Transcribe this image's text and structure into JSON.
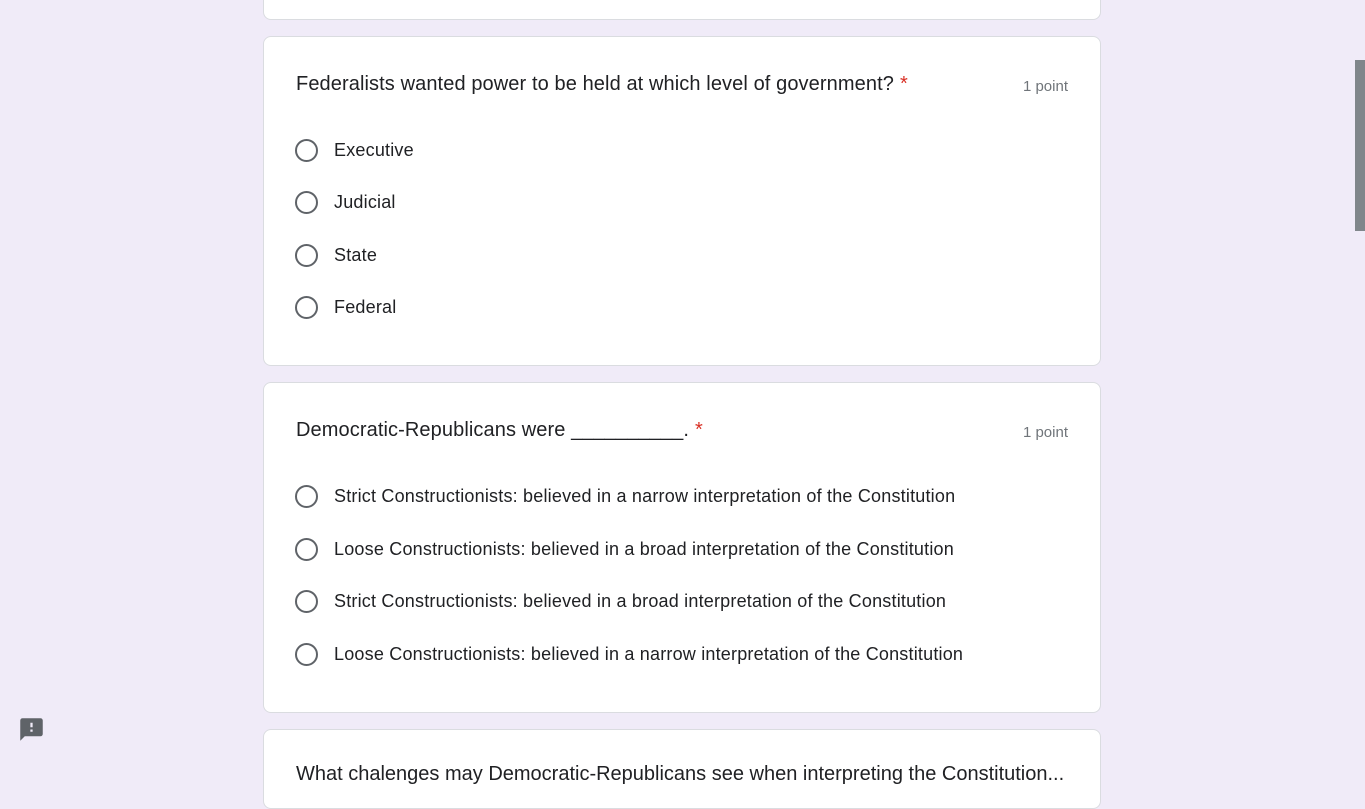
{
  "questions": [
    {
      "title": "Federalists wanted power to be held at which level of government?",
      "required_mark": "*",
      "points": "1 point",
      "options": [
        "Executive",
        "Judicial",
        "State",
        "Federal"
      ]
    },
    {
      "title": "Democratic-Republicans were __________.",
      "required_mark": "*",
      "points": "1 point",
      "options": [
        "Strict Constructionists: believed in a narrow interpretation of the Constitution",
        "Loose Constructionists: believed in a broad interpretation of the Constitution",
        "Strict Constructionists: believed in a broad interpretation of the Constitution",
        "Loose Constructionists: believed in a narrow interpretation of the Constitution"
      ]
    }
  ],
  "next_question": {
    "title": "What chalenges may Democratic-Republicans see when interpreting the Constitution..."
  },
  "icons": {
    "feedback": "report-feedback-icon"
  },
  "colors": {
    "background": "#f0ebf8",
    "required": "#d93025",
    "card_border": "#dadce0"
  }
}
